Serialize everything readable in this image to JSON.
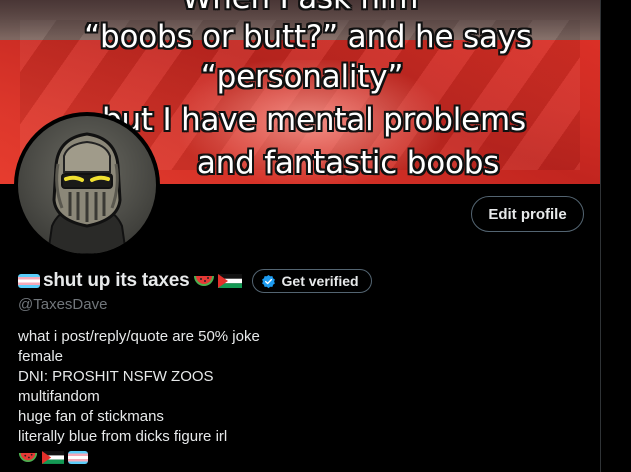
{
  "banner": {
    "caption_lines": [
      "When I ask him",
      "“boobs or butt?” and he says",
      "“personality”",
      "but I have mental problems",
      "and fantastic boobs"
    ]
  },
  "profile": {
    "display_name": "shut up its taxes",
    "handle": "@TaxesDave",
    "edit_profile_label": "Edit profile",
    "get_verified_label": "Get verified",
    "bio_lines": [
      "what i post/reply/quote are 50% joke",
      "female",
      "DNI: PROSHIT NSFW ZOOS",
      "multifandom",
      "huge fan of stickmans",
      "literally blue from dicks figure irl"
    ],
    "name_emoji": [
      "transgender-flag",
      "watermelon",
      "palestine-flag"
    ],
    "bio_emoji": [
      "watermelon",
      "palestine-flag",
      "transgender-flag"
    ]
  },
  "colors": {
    "background": "#000000",
    "text": "#e7e9ea",
    "muted": "#71767b",
    "border": "#536471",
    "verified_blue": "#1d9bf0"
  }
}
